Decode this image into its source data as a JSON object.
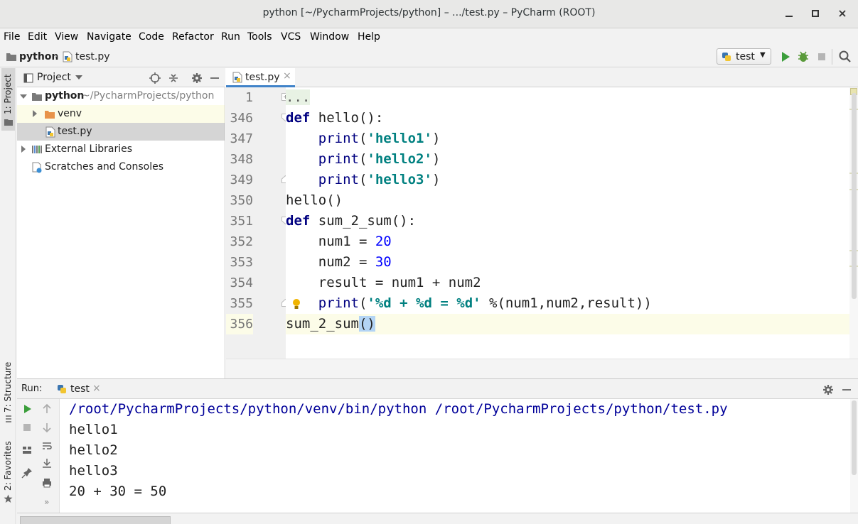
{
  "window": {
    "title": "python [~/PycharmProjects/python] – .../test.py – PyCharm (ROOT)",
    "minimize": "_",
    "maximize": "□",
    "close": "✕"
  },
  "menu": [
    "File",
    "Edit",
    "View",
    "Navigate",
    "Code",
    "Refactor",
    "Run",
    "Tools",
    "VCS",
    "Window",
    "Help"
  ],
  "breadcrumb": {
    "project": "python",
    "file": "test.py"
  },
  "run_config": {
    "label": "test",
    "dropdown": "▼"
  },
  "sidebar_tabs": {
    "project": "1: Project",
    "structure": "7: Structure",
    "favorites": "2: Favorites"
  },
  "project_panel": {
    "title": "Project",
    "root_name": "python",
    "root_path": "~/PycharmProjects/python",
    "venv": "venv",
    "file": "test.py",
    "external": "External Libraries",
    "scratches": "Scratches and Consoles"
  },
  "editor": {
    "tab_label": "test.py",
    "tab_close": "×",
    "lines": [
      {
        "num": "1",
        "text": "..."
      },
      {
        "num": "346",
        "text": "def hello():"
      },
      {
        "num": "347",
        "text": "    print('hello1')"
      },
      {
        "num": "348",
        "text": "    print('hello2')"
      },
      {
        "num": "349",
        "text": "    print('hello3')"
      },
      {
        "num": "350",
        "text": "hello()"
      },
      {
        "num": "351",
        "text": "def sum_2_sum():"
      },
      {
        "num": "352",
        "text": "    num1 = 20"
      },
      {
        "num": "353",
        "text": "    num2 = 30"
      },
      {
        "num": "354",
        "text": "    result = num1 + num2"
      },
      {
        "num": "355",
        "text": "    print('%d + %d = %d' %(num1,num2,result))"
      },
      {
        "num": "356",
        "text": "sum_2_sum()"
      }
    ]
  },
  "run_panel": {
    "label": "Run:",
    "tab": "test",
    "tab_close": "×",
    "output": [
      "/root/PycharmProjects/python/venv/bin/python /root/PycharmProjects/python/test.py",
      "hello1",
      "hello2",
      "hello3",
      "20 + 30 = 50"
    ]
  }
}
